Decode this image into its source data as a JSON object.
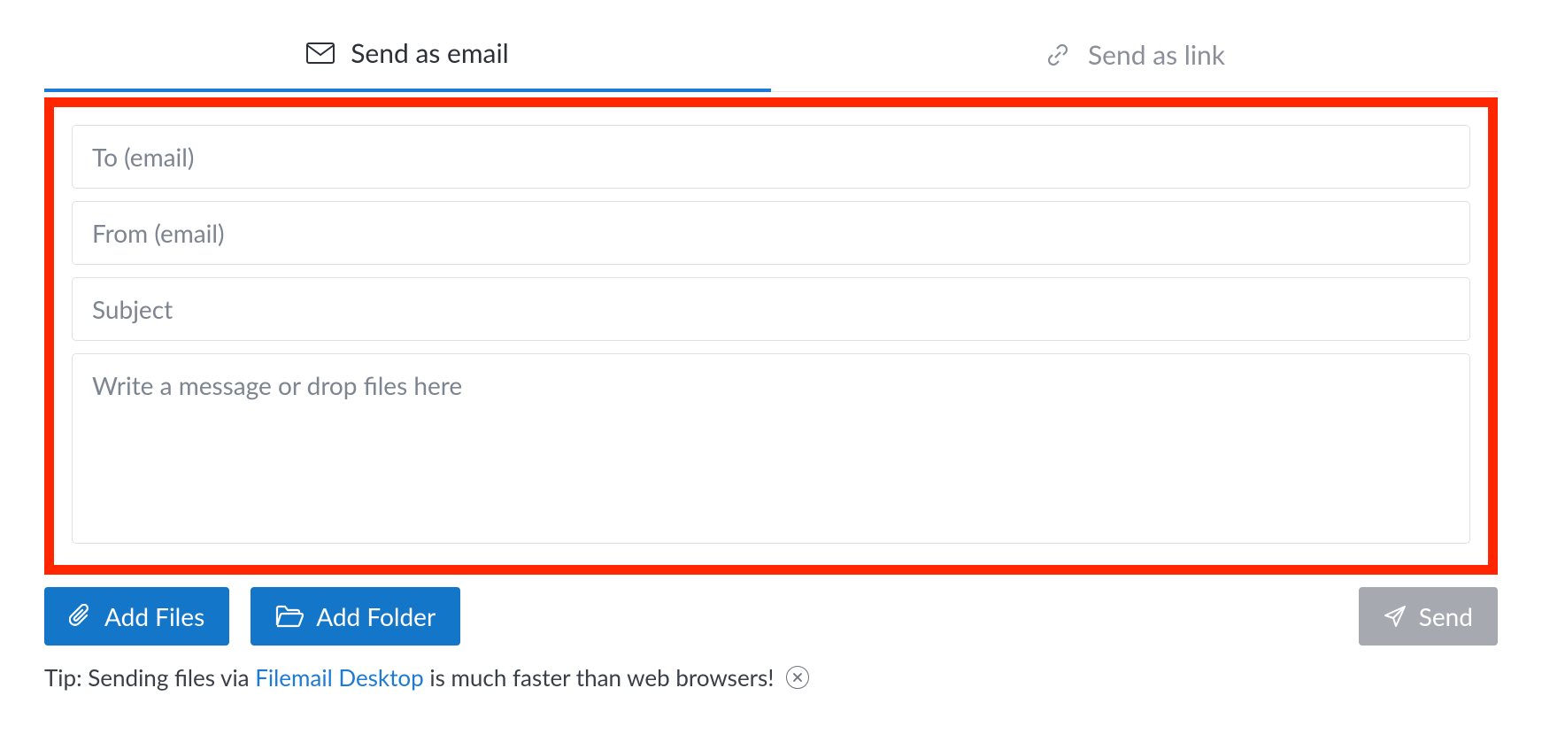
{
  "tabs": {
    "email": {
      "label": "Send as email"
    },
    "link": {
      "label": "Send as link"
    }
  },
  "form": {
    "to_placeholder": "To (email)",
    "from_placeholder": "From (email)",
    "subject_placeholder": "Subject",
    "message_placeholder": "Write a message or drop files here"
  },
  "buttons": {
    "add_files": "Add Files",
    "add_folder": "Add Folder",
    "send": "Send"
  },
  "tip": {
    "prefix": "Tip: Sending files via ",
    "link_text": "Filemail Desktop",
    "suffix": " is much faster than web browsers!"
  }
}
